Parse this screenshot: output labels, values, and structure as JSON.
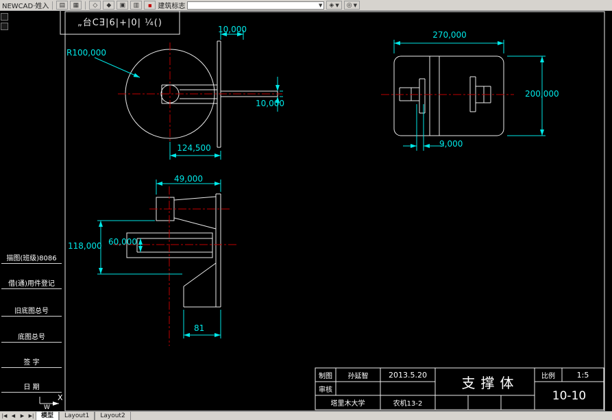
{
  "toolbar": {
    "title_label": "NEWCAD·姓入",
    "icons": [
      {
        "name": "new-doc-icon",
        "glyph": "▤"
      },
      {
        "name": "grid-icon",
        "glyph": "▦"
      },
      {
        "name": "diamond-outline-icon",
        "glyph": "◇"
      },
      {
        "name": "diamond-filled-icon",
        "glyph": "◆"
      },
      {
        "name": "layers-icon",
        "glyph": "▣"
      },
      {
        "name": "palette-icon",
        "glyph": "▥"
      },
      {
        "name": "stamp-icon",
        "glyph": "■"
      }
    ],
    "stamp_label": "建筑标志",
    "combo_value": "",
    "chevron": "▼",
    "right_tools": [
      {
        "name": "zoom-tool-icon",
        "glyph": "◈"
      },
      {
        "name": "snap-tool-icon",
        "glyph": "◎"
      }
    ]
  },
  "drawing": {
    "corner_stamp": "„台CƎ|6|+|0| ¼()",
    "ucs_x_label": "X",
    "ucs_w_label": "W"
  },
  "dims": {
    "top10": "10,000",
    "r100": "R100,000",
    "right10": "10,000",
    "d124": "124,500",
    "d270": "270,000",
    "d200": "200,000",
    "d9": "9,000",
    "d49": "49,000",
    "d118": "118,000",
    "d60": "60,000",
    "d81": "81"
  },
  "side_labels": [
    "描图(班级)8086",
    "借(通)用件登记",
    "旧底图总号",
    "底图总号",
    "签 字",
    "日 期"
  ],
  "title_block": {
    "draw_label": "制图",
    "draw_name": "孙延智",
    "date": "2013.5.20",
    "part": "支撑体",
    "scale_label": "比例",
    "scale_value": "1:5",
    "check_label": "审核",
    "sheet_no": "10-10",
    "school": "塔里木大学",
    "class_no": "农机13-2"
  },
  "status": {
    "nav": [
      "|◀",
      "◀",
      "▶",
      "▶|"
    ],
    "tabs": [
      "模型",
      "Layout1",
      "Layout2"
    ]
  }
}
